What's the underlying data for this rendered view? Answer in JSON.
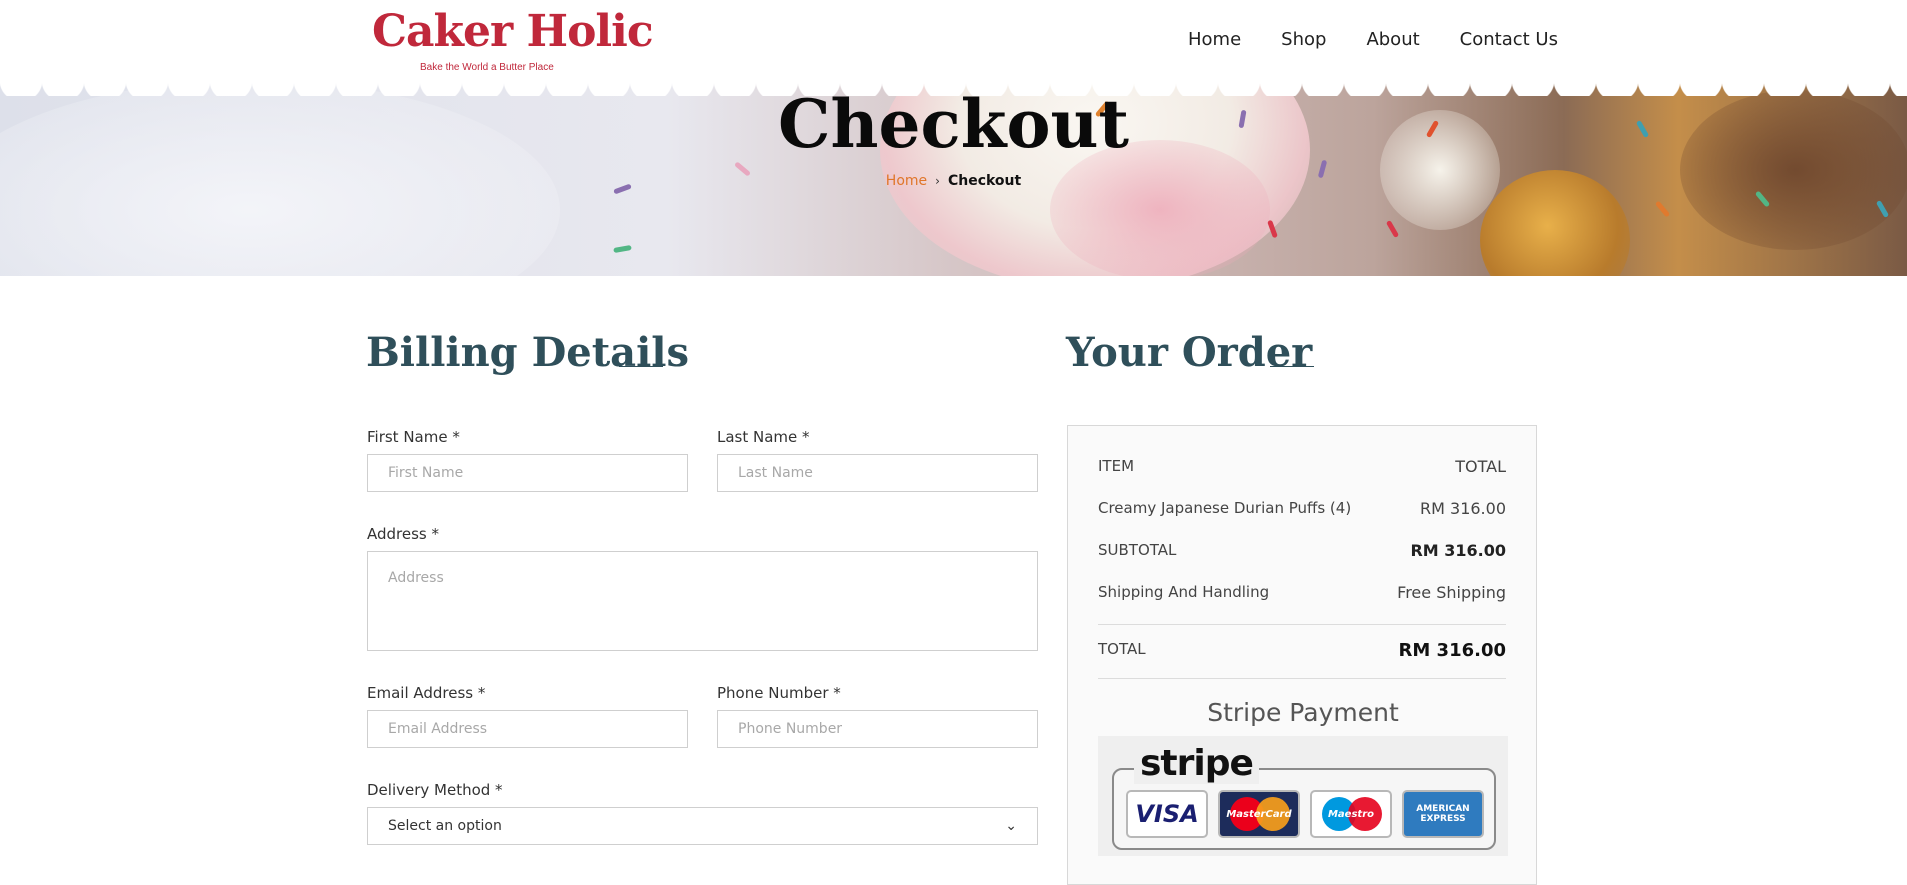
{
  "header": {
    "logo_title": "Caker Holic",
    "logo_tagline": "Bake the World a Butter Place",
    "nav": [
      "Home",
      "Shop",
      "About",
      "Contact Us"
    ]
  },
  "hero": {
    "title": "Checkout",
    "breadcrumb": {
      "home": "Home",
      "separator": "›",
      "current": "Checkout"
    }
  },
  "billing": {
    "heading": "Billing Details",
    "first_name": {
      "label": "First Name *",
      "placeholder": "First Name",
      "value": ""
    },
    "last_name": {
      "label": "Last Name *",
      "placeholder": "Last Name",
      "value": ""
    },
    "address": {
      "label": "Address *",
      "placeholder": "Address",
      "value": ""
    },
    "email": {
      "label": "Email Address *",
      "placeholder": "Email Address",
      "value": ""
    },
    "phone": {
      "label": "Phone Number *",
      "placeholder": "Phone Number",
      "value": ""
    },
    "delivery": {
      "label": "Delivery Method *",
      "selected": "Select an option"
    }
  },
  "order": {
    "heading": "Your Order",
    "item_header": "ITEM",
    "total_header": "TOTAL",
    "item_name": "Creamy Japanese Durian Puffs (4)",
    "item_price": "RM 316.00",
    "subtotal_label": "SUBTOTAL",
    "subtotal_value": "RM 316.00",
    "shipping_label": "Shipping And Handling",
    "shipping_value": "Free Shipping",
    "total_label": "TOTAL",
    "total_value": "RM 316.00",
    "payment_title": "Stripe Payment",
    "payment_logo": "stripe",
    "cards": [
      "VISA",
      "MasterCard",
      "Maestro",
      "AMERICAN EXPRESS"
    ]
  },
  "colors": {
    "brand": "#c0283b",
    "heading": "#2f4f5a",
    "breadcrumb_link": "#e0762a"
  }
}
